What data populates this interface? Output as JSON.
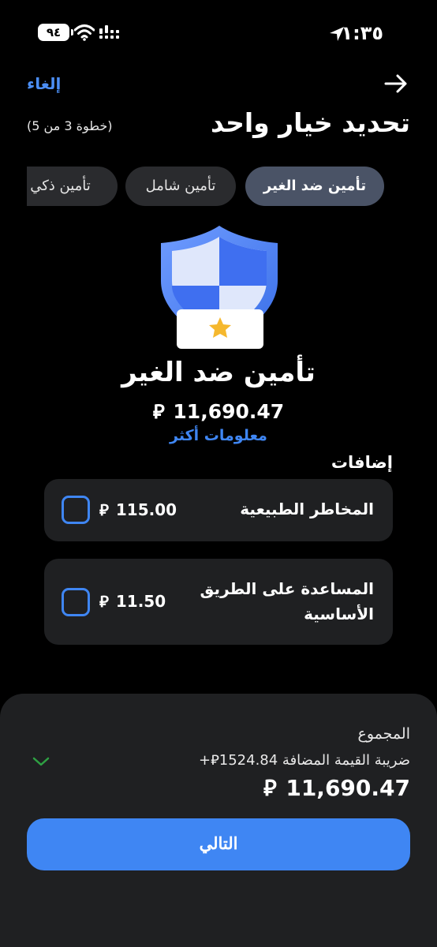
{
  "status_bar": {
    "time": "١:٣٥",
    "battery": "٩٤"
  },
  "header": {
    "cancel": "إلغاء",
    "title": "تحديد خيار واحد",
    "step": "(خطوة 3 من 5)"
  },
  "tabs": [
    {
      "label": "تأمين ضد الغير",
      "active": true
    },
    {
      "label": "تأمين شامل",
      "active": false
    },
    {
      "label": "تأمين ذكي",
      "active": false
    }
  ],
  "product": {
    "name": "تأمين ضد الغير",
    "price": "11,690.47",
    "currency_symbol": "⃁",
    "more_info": "معلومات أكثر"
  },
  "addons": {
    "title": "إضافات",
    "items": [
      {
        "name": "المخاطر الطبيعية",
        "price": "115.00",
        "checked": false
      },
      {
        "name": "المساعدة على الطريق الأساسية",
        "price": "11.50",
        "checked": false
      }
    ]
  },
  "summary": {
    "total_label": "المجموع",
    "vat_text": "ضريبة القيمة المضافة 1524.84⃁+",
    "total": "11,690.47"
  },
  "actions": {
    "next": "التالي"
  },
  "colors": {
    "accent": "#3f86f3",
    "active_tab": "#4a5366",
    "card": "#1f2022",
    "chevron": "#2ea043"
  }
}
